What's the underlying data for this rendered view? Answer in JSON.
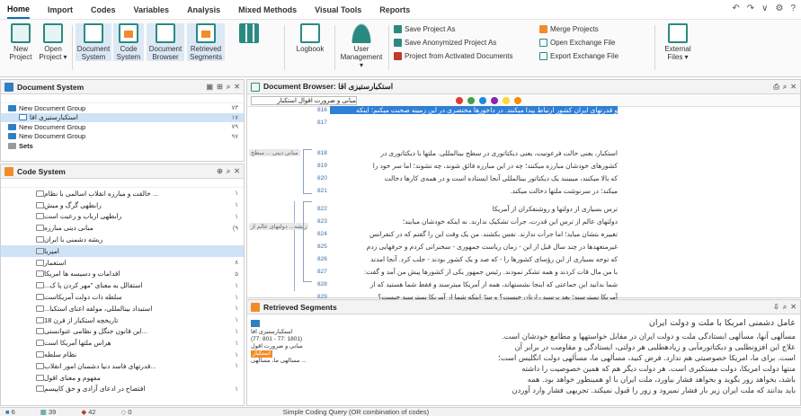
{
  "menu": [
    "Home",
    "Import",
    "Codes",
    "Variables",
    "Analysis",
    "Mixed Methods",
    "Visual Tools",
    "Reports"
  ],
  "window_controls": [
    "↶",
    "↷",
    "∨",
    "⚙",
    "?"
  ],
  "ribbon": {
    "new_project": [
      "New",
      "Project"
    ],
    "open_project": [
      "Open",
      "Project ▾"
    ],
    "document_system": [
      "Document",
      "System"
    ],
    "code_system": [
      "Code",
      "System"
    ],
    "document_browser": [
      "Document",
      "Browser"
    ],
    "retrieved_segments": [
      "Retrieved",
      "Segments"
    ],
    "logbook": "Logbook",
    "user_management": [
      "User",
      "Management ▾"
    ],
    "save_project_as": "Save Project As",
    "save_anonymized": "Save Anonymized Project As",
    "project_from_activated": "Project from Activated Documents",
    "merge_projects": "Merge Projects",
    "open_exchange_file": "Open Exchange File",
    "export_exchange_file": "Export Exchange File",
    "external_files": [
      "External",
      "Files ▾"
    ]
  },
  "document_system": {
    "title": "Document System",
    "items": [
      {
        "label": "New Document Group",
        "count": "۷۳",
        "level": 0,
        "kind": "group"
      },
      {
        "label": "استکبارستیزی اقا",
        "count": "۱۷",
        "level": 1,
        "kind": "doc",
        "selected": true
      },
      {
        "label": "New Document Group",
        "count": "۷۹",
        "level": 0,
        "kind": "group"
      },
      {
        "label": "New Document Group",
        "count": "۹۷",
        "level": 0,
        "kind": "group"
      },
      {
        "label": "Sets",
        "count": "",
        "level": 0,
        "kind": "sets"
      }
    ]
  },
  "code_system": {
    "title": "Code System",
    "items": [
      {
        "label": "... خالقت و مبارزه انقلاب اسالمی با نظام",
        "count": "۱"
      },
      {
        "label": "رابطهی گرگ و میش",
        "count": "۱"
      },
      {
        "label": "رابطهی ارباب و رعیت است",
        "count": "۱"
      },
      {
        "label": "مبانی دینی مبارزه",
        "count": "(۹"
      },
      {
        "label": "ریشه دشمنی با ایران",
        "count": ""
      },
      {
        "label": "امپریا",
        "count": "",
        "highlight": true
      },
      {
        "label": "استعمار",
        "count": "۸"
      },
      {
        "label": "اقدامات و دسیسه ها امریکا",
        "count": "۵"
      },
      {
        "label": "استقالل به معنای \"مهر کردن پا ک...",
        "count": "۱"
      },
      {
        "label": "سلطه ذات دولت آمریکاست",
        "count": "۱"
      },
      {
        "label": "استبداد بینالمللی، مولفه اعتای استکبا...",
        "count": "۱"
      },
      {
        "label": "تاریخچه استکبار از قرن 18",
        "count": "۱"
      },
      {
        "label": "...این قانون جنگل و نظامی عنوانستی",
        "count": "۱"
      },
      {
        "label": "هراس ملتها آمریکا است",
        "count": "۱"
      },
      {
        "label": "نظام سلطه",
        "count": "۱"
      },
      {
        "label": "...قدرتهای فاسد دنیا دشمنان امور انقلاب",
        "count": "۱"
      },
      {
        "label": "مفهوم و معنای اقول",
        "count": ""
      },
      {
        "label": "افتضاح در ادعای آزادی و حق کاپیسم",
        "count": "۱"
      }
    ]
  },
  "document_browser": {
    "title": "Document Browser: استکبارستیزی اقا",
    "dropdown": "مبانی و ضرورت اقوال استکبار",
    "lines": [
      {
        "no": "816",
        "text": "و قدرتهای ایران کشور ارتباط پیدا میکنند. در داخ‍ورها مختصری در این زمینه صحبت میکنم؛ اینکه",
        "highlight": true
      },
      {
        "no": "817",
        "text": ""
      },
      {
        "no": "818",
        "text": "استکبار، یعنی حالت فرعونیت، یعنی دیکتاتوری در سطح بینالمللی. ملتها با دیکتاتوری در"
      },
      {
        "no": "819",
        "text": "کشورهای خودشان مبارزه میکنند؛ چه در این مبارزه فائق شوند، چه نشوند؛ اما سر خود را"
      },
      {
        "no": "820",
        "text": "که بالا میکنند، میبینند یک دیکتاتور بینالمللی آنجا ایستاده است و در همه‌ی کارها دخالت"
      },
      {
        "no": "821",
        "text": "میکند؛ در سرنوشت ملتها دخالت میکند."
      },
      {
        "no": "822",
        "text": "ترس بسیاری از دولتها و روشنفکران از آمریکا"
      },
      {
        "no": "823",
        "text": "دولتهای عالم از ترس این قدرت، جرأت تشکیک ندارند. نه اینکه خودشان مبایند؛"
      },
      {
        "no": "824",
        "text": "تغییرہ بتشان میاید؛ اما جرأت ندارند. نفس بکشند. من یک وقت این را گفتم که در کنفرانس"
      },
      {
        "no": "825",
        "text": "غیرمتعهدها در چند سال قبل از این - زمان ریاست جمهوری - سخنرانی کردم و حرفهایی زدم"
      },
      {
        "no": "826",
        "text": "که توجه بسیاری از این رؤسای کشورها را - که صد و یک کشور بودند - جلب کرد. آنجا امدند"
      },
      {
        "no": "827",
        "text": "با من مال قات کردند و همه تشکر نمودند. رئیس جمهور یکی از کشورها پیش من آمد و گفت:"
      },
      {
        "no": "828",
        "text": "شما بدانید این جماعتی که اینجا نشستهاند، همه از آمریکا میترسند و فقط شما هستید که از"
      },
      {
        "no": "829",
        "text": "آمریکا نمیترسید؛ بعد پرسید رازتان چیست؟ و سرّ اینکه شما از آمریکا نمیترسید چیست؟"
      }
    ],
    "segment_labels": [
      "مبانی دینی ... سطح",
      "ریشه... دولتهای عالم از"
    ]
  },
  "retrieved_segments": {
    "title": "Retrieved Segments",
    "entry": {
      "doc": "استکبارستیزی اقا",
      "pos": "(77: 801 - 77: 1801)",
      "code1": "مبانی و ضرورت اقول",
      "code2": "استکبار",
      "code3": "... مسالهی ما، مسالهی"
    },
    "heading": "عامل دشمنی امریکا با ملت و دولت ایران",
    "paragraph": [
      "مسألهی آنها، مسألهی ایستادگی ملت و دولت ایران در مقابل خواستهها و مطامع خودشان است.",
      "علاج این افزونطلبی و دیکتاتورمآبی و زیادهطلبی هر دولتی، ایستادگی و مقاومت در برابر آن",
      "است. برای ما، امریکا خصوصیتی هم ندارد. فرض کنید، مسألهی ما، مسألهی دولت انگلیس است؛",
      "منتها دولت امریکا، دولت مستکبری است. هر دولت دیگر هم که همین خصوصیت را داشته",
      "باشد، بخواهد زور بگوید و بخواهد فشار بیاورد، ملت ایران با او همینطور خواهد بود. همه",
      "باید بدانند که ملت ایران زیر بار فشار نمیرود و زور را قبول نمیکند. تجربهی فشار وارد آوردن"
    ]
  },
  "status": {
    "docs": "6",
    "codes": "39",
    "segments": "42",
    "memos": "0",
    "query": "Simple Coding Query (OR combination of codes)"
  }
}
